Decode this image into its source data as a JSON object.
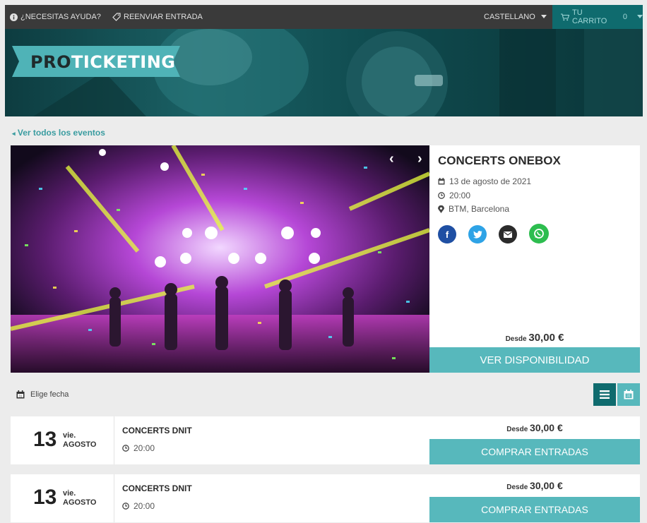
{
  "topbar": {
    "help": "¿NECESITAS AYUDA?",
    "resend": "REENVIAR ENTRADA",
    "language": "CASTELLANO",
    "cart_label": "TU CARRITO",
    "cart_count": "0"
  },
  "brand": {
    "logo_pro": "PRO",
    "logo_ticketing": "TICKETING"
  },
  "nav": {
    "back_link": "Ver todos los eventos"
  },
  "event": {
    "title": "CONCERTS ONEBOX",
    "date": "13 de agosto de 2021",
    "time": "20:00",
    "venue": "BTM, Barcelona",
    "from_label": "Desde",
    "price": "30,00 €",
    "availability_button": "VER DISPONIBILIDAD"
  },
  "date_picker": {
    "label": "Elige fecha"
  },
  "sessions": [
    {
      "day": "13",
      "weekday": "vie.",
      "month": "AGOSTO",
      "name": "CONCERTS DNIT",
      "time": "20:00",
      "from_label": "Desde",
      "price": "30,00 €",
      "button": "COMPRAR ENTRADAS"
    },
    {
      "day": "13",
      "weekday": "vie.",
      "month": "AGOSTO",
      "name": "CONCERTS DNIT",
      "time": "20:00",
      "from_label": "Desde",
      "price": "30,00 €",
      "button": "COMPRAR ENTRADAS"
    }
  ],
  "colors": {
    "teal": "#57b8bc",
    "dark_teal": "#0f6b6e",
    "topbar": "#3a3a3a",
    "link": "#3a9ca0"
  },
  "icons": {
    "help": "info-circle-icon",
    "resend": "tag-icon",
    "language": "caret-down-icon",
    "cart": "cart-icon",
    "back": "chevron-left-icon",
    "calendar": "calendar-icon",
    "clock": "clock-icon",
    "location": "map-pin-icon",
    "list_view": "list-icon",
    "calendar_view": "calendar-icon"
  }
}
